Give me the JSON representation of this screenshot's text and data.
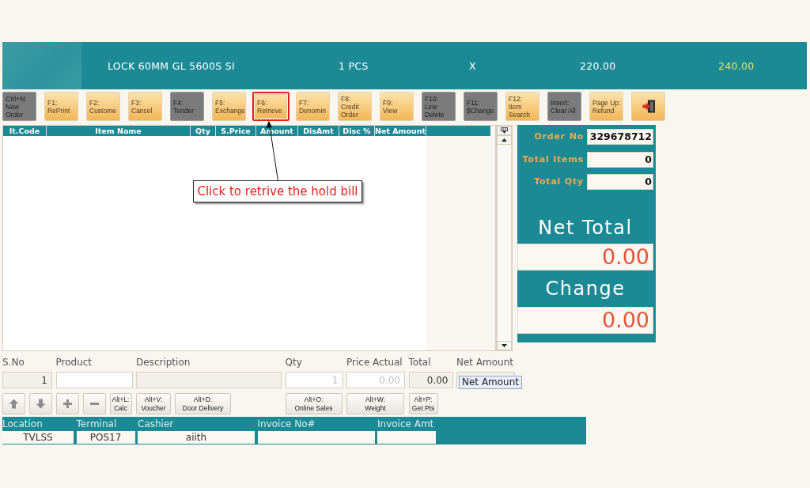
{
  "banner": {
    "item_name": "LOCK 60MM GL 5600S SI",
    "quantity": "1 PCS",
    "multiplier": "X",
    "price": "220.00",
    "amount": "240.00"
  },
  "toolbar": [
    {
      "kind": "text",
      "key": "Ctrl+N:",
      "label": "New Order",
      "disabled": true,
      "highlighted": false
    },
    {
      "kind": "text",
      "key": "F1:",
      "label": "RePrint",
      "disabled": false,
      "highlighted": false
    },
    {
      "kind": "text",
      "key": "F2:",
      "label": "Custome",
      "disabled": false,
      "highlighted": false
    },
    {
      "kind": "text",
      "key": "F3:",
      "label": "Cancel",
      "disabled": false,
      "highlighted": false
    },
    {
      "kind": "text",
      "key": "F4:",
      "label": "Tender",
      "disabled": true,
      "highlighted": false
    },
    {
      "kind": "text",
      "key": "F5:",
      "label": "Exchange",
      "disabled": false,
      "highlighted": false
    },
    {
      "kind": "text",
      "key": "F6:",
      "label": "Retrieve",
      "disabled": false,
      "highlighted": true
    },
    {
      "kind": "text",
      "key": "F7:",
      "label": "Denomin",
      "disabled": false,
      "highlighted": false
    },
    {
      "kind": "text",
      "key": "F8:",
      "label": "Credit Order",
      "disabled": false,
      "highlighted": false
    },
    {
      "kind": "text",
      "key": "F9:",
      "label": "View",
      "disabled": false,
      "highlighted": false
    },
    {
      "kind": "text",
      "key": "F10:",
      "label": "Line Delete",
      "disabled": true,
      "highlighted": false
    },
    {
      "kind": "text",
      "key": "F11:",
      "label": "$Change",
      "disabled": true,
      "highlighted": false
    },
    {
      "kind": "text",
      "key": "F12:",
      "label": "Item Search",
      "disabled": false,
      "highlighted": false
    },
    {
      "kind": "text",
      "key": "Insert:",
      "label": "Clear All",
      "disabled": true,
      "highlighted": false
    },
    {
      "kind": "text",
      "key": "Page Up:",
      "label": "Refund",
      "disabled": false,
      "highlighted": false
    },
    {
      "kind": "icon",
      "disabled": false,
      "highlighted": false
    }
  ],
  "callout": {
    "text": "Click to retrive the hold bill"
  },
  "table": {
    "columns": [
      "It.Code",
      "Item Name",
      "Qty",
      "S.Price",
      "Amount",
      "DisAmt",
      "Disc %",
      "Net Amount"
    ]
  },
  "summary": {
    "fields": [
      {
        "label": "Order No",
        "value": "329678712"
      },
      {
        "label": "Total Items",
        "value": "0"
      },
      {
        "label": "Total Qty",
        "value": "0"
      }
    ],
    "net_total": {
      "label": "Net Total",
      "value": "0.00"
    },
    "change": {
      "label": "Change",
      "value": "0.00"
    }
  },
  "entry": {
    "fields": [
      {
        "label": "S.No",
        "value": "1",
        "readonly": true
      },
      {
        "label": "Product",
        "readonly": false
      },
      {
        "label": "Description",
        "readonly": true
      },
      {
        "label": "Qty",
        "placeholder": "1",
        "readonly": false
      },
      {
        "label": "Price Actual",
        "placeholder": "0.00",
        "readonly": false
      },
      {
        "label": "Total",
        "value": "0.00",
        "readonly": true
      },
      {
        "label": "Net Amount",
        "readonly": true
      }
    ],
    "buttons": [
      {
        "kind": "up"
      },
      {
        "kind": "down"
      },
      {
        "kind": "plus"
      },
      {
        "kind": "minus"
      },
      {
        "kind": "text",
        "key": "Alt+L:",
        "label": "Calc"
      },
      {
        "kind": "text",
        "key": "Alt+V:",
        "label": "Voucher"
      },
      {
        "kind": "text",
        "key": "Alt+D:",
        "label": "Door Delivery"
      },
      {
        "kind": "text",
        "key": "Alt+O:",
        "label": "Online Sales"
      },
      {
        "kind": "text",
        "key": "Alt+W:",
        "label": "Weight"
      },
      {
        "kind": "text",
        "key": "Alt+P:",
        "label": "Get Pts"
      }
    ],
    "tooltip": "Net Amount"
  },
  "status_bar": {
    "fields": [
      {
        "label": "Location",
        "value": "TVLSS"
      },
      {
        "label": "Terminal",
        "value": "POS17"
      },
      {
        "label": "Cashier",
        "value": "aiith"
      },
      {
        "label": "Invoice No#"
      },
      {
        "label": "Invoice Amt"
      }
    ]
  }
}
